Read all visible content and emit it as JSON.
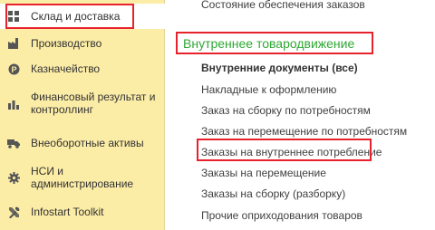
{
  "sidebar": {
    "items": [
      {
        "label": "Склад и доставка",
        "icon": "grid-icon",
        "active": true
      },
      {
        "label": "Производство",
        "icon": "factory-icon"
      },
      {
        "label": "Казначейство",
        "icon": "coin-icon"
      },
      {
        "label": "Финансовый результат и контроллинг",
        "icon": "bar-chart-icon"
      },
      {
        "label": "Внеоборотные активы",
        "icon": "truck-icon"
      },
      {
        "label": "НСИ и администрирование",
        "icon": "gear-icon"
      },
      {
        "label": "Infostart Toolkit",
        "icon": "tools-icon"
      }
    ]
  },
  "main": {
    "top_link": "Состояние обеспечения заказов",
    "section_title": "Внутреннее товародвижение",
    "links": [
      {
        "label": "Внутренние документы (все)",
        "bold": true
      },
      {
        "label": "Накладные к оформлению"
      },
      {
        "label": "Заказ на сборку по потребностям"
      },
      {
        "label": "Заказ на перемещение по потребностям"
      },
      {
        "label": "Заказы на внутреннее потребление"
      },
      {
        "label": "Заказы на перемещение"
      },
      {
        "label": "Заказы на сборку (разборку)"
      },
      {
        "label": "Прочие оприходования товаров"
      }
    ]
  },
  "colors": {
    "sidebar_bg": "#fbeca6",
    "section_title": "#2fa834",
    "highlight": "#e8222c"
  }
}
